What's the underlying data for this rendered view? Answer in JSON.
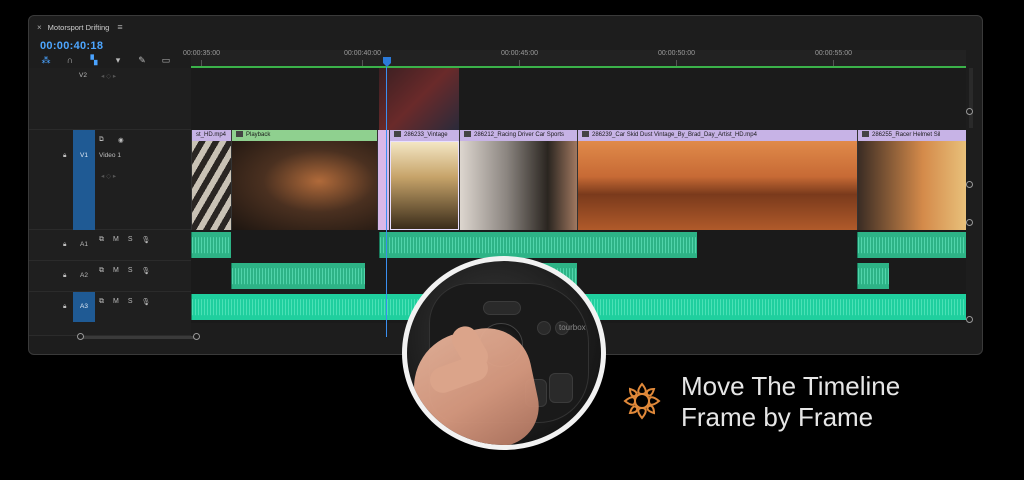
{
  "panel": {
    "title": "Motorsport Drifting",
    "timecode": "00:00:40:18"
  },
  "ruler": {
    "ticks": [
      "00:00:35:00",
      "00:00:40:00",
      "00:00:45:00",
      "00:00:50:00",
      "00:00:55:00"
    ]
  },
  "tracks": {
    "v2": {
      "id": "V2"
    },
    "v1": {
      "id": "V1",
      "name": "Video 1"
    },
    "a1": {
      "id": "A1"
    },
    "a2": {
      "id": "A2"
    },
    "a3": {
      "id": "A3"
    },
    "controls": {
      "mute": "M",
      "solo": "S"
    }
  },
  "clips": {
    "c1": "st_HD.mp4",
    "c2": "Playback",
    "c3": "286233_Vintage",
    "c4": "286212_Racing Driver Car Sports",
    "c5": "286239_Car Skid Dust Vintage_By_Brad_Day_Artist_HD.mp4",
    "c6": "286255_Racer Helmet Sil"
  },
  "device": {
    "brand": "tourbox"
  },
  "caption": {
    "line1": "Move The Timeline",
    "line2": "Frame by Frame"
  },
  "colors": {
    "accent": "#4da6ff",
    "audio": "#2db386",
    "clip_header": "#c7b3e6",
    "caption_icon": "#e0893a"
  }
}
